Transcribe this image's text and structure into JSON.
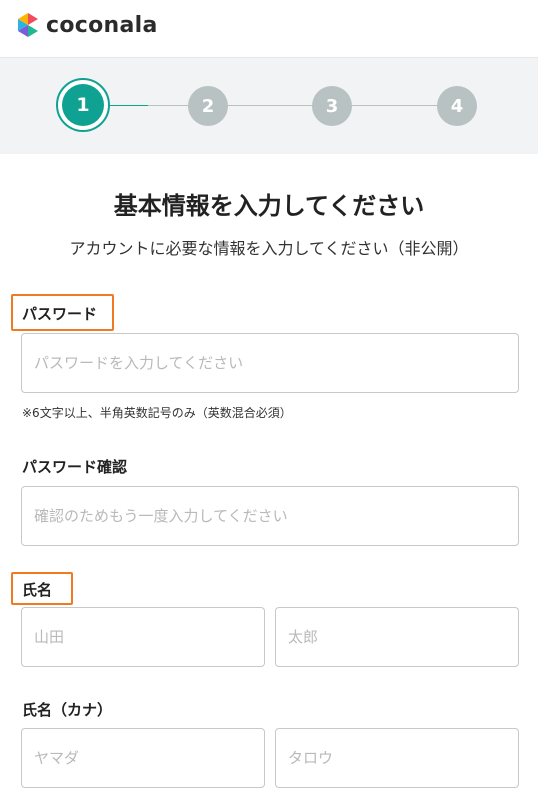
{
  "header": {
    "logo_text": "coconala"
  },
  "stepper": {
    "steps": [
      "1",
      "2",
      "3",
      "4"
    ],
    "current": 1
  },
  "main": {
    "title": "基本情報を入力してください",
    "subtitle": "アカウントに必要な情報を入力してください（非公開）"
  },
  "form": {
    "password": {
      "label": "パスワード",
      "placeholder": "パスワードを入力してください",
      "hint": "※6文字以上、半角英数記号のみ（英数混合必須）"
    },
    "password_confirm": {
      "label": "パスワード確認",
      "placeholder": "確認のためもう一度入力してください"
    },
    "name": {
      "label": "氏名",
      "last_placeholder": "山田",
      "first_placeholder": "太郎"
    },
    "name_kana": {
      "label": "氏名（カナ）",
      "last_placeholder": "ヤマダ",
      "first_placeholder": "タロウ"
    }
  },
  "colors": {
    "accent": "#0fa292",
    "step_inactive": "#b8c2c2",
    "highlight": "#f07a22"
  }
}
